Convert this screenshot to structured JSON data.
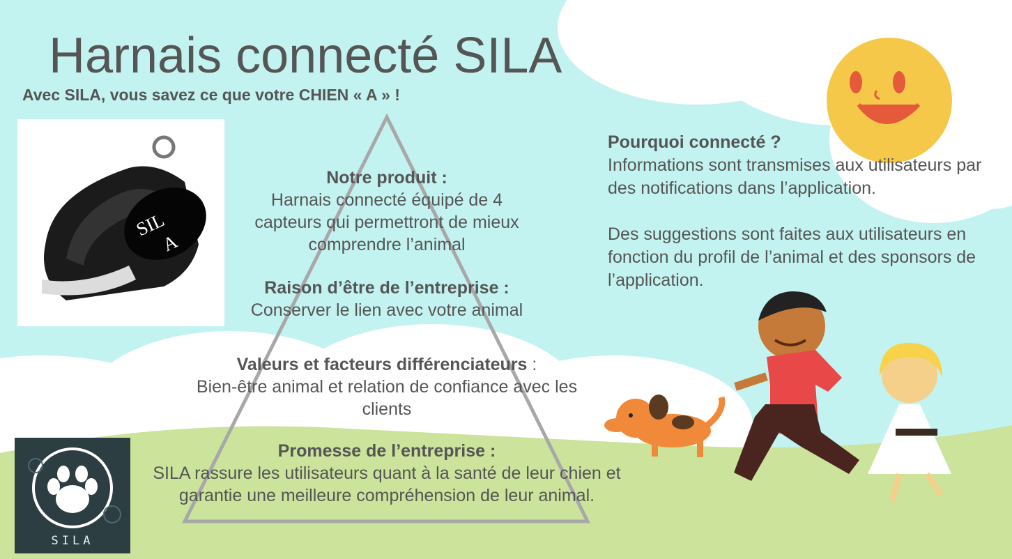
{
  "title": "Harnais connecté SILA",
  "tagline": "Avec SILA, vous savez ce que votre CHIEN « A » !",
  "harness_image": {
    "icon": "harness-illustration",
    "label_line1": "SIL",
    "label_line2": "A"
  },
  "pyramid": [
    {
      "heading": "Notre produit :",
      "body": "Harnais connecté équipé de 4 capteurs qui permettront de mieux comprendre l’animal"
    },
    {
      "heading": "Raison d’être de l’entreprise :",
      "body": "Conserver le lien avec votre animal"
    },
    {
      "heading": "Valeurs et facteurs différenciateurs",
      "heading_suffix": " :",
      "body": "Bien-être animal et relation de confiance avec les clients"
    },
    {
      "heading": "Promesse de l’entreprise :",
      "body": "SILA rassure les utilisateurs quant à la santé de leur chien et garantie une meilleure compréhension de leur animal."
    }
  ],
  "connected": {
    "heading": "Pourquoi connecté ?",
    "para1": "Informations sont transmises aux utilisateurs par des notifications dans l’application.",
    "para2": "Des suggestions sont faites aux utilisateurs en fonction du profil de l’animal et des sponsors de l’application."
  },
  "logo": {
    "icon": "paw-icon",
    "text": "SILA"
  },
  "decor": {
    "sun": "sun-icon",
    "children": "children-playing-illustration",
    "dog": "dog-icon"
  },
  "colors": {
    "sky": "#c3f3f0",
    "grass": "#cbe39b",
    "text": "#555555",
    "triangle": "#a8a8a8",
    "sun": "#f5c84a"
  }
}
